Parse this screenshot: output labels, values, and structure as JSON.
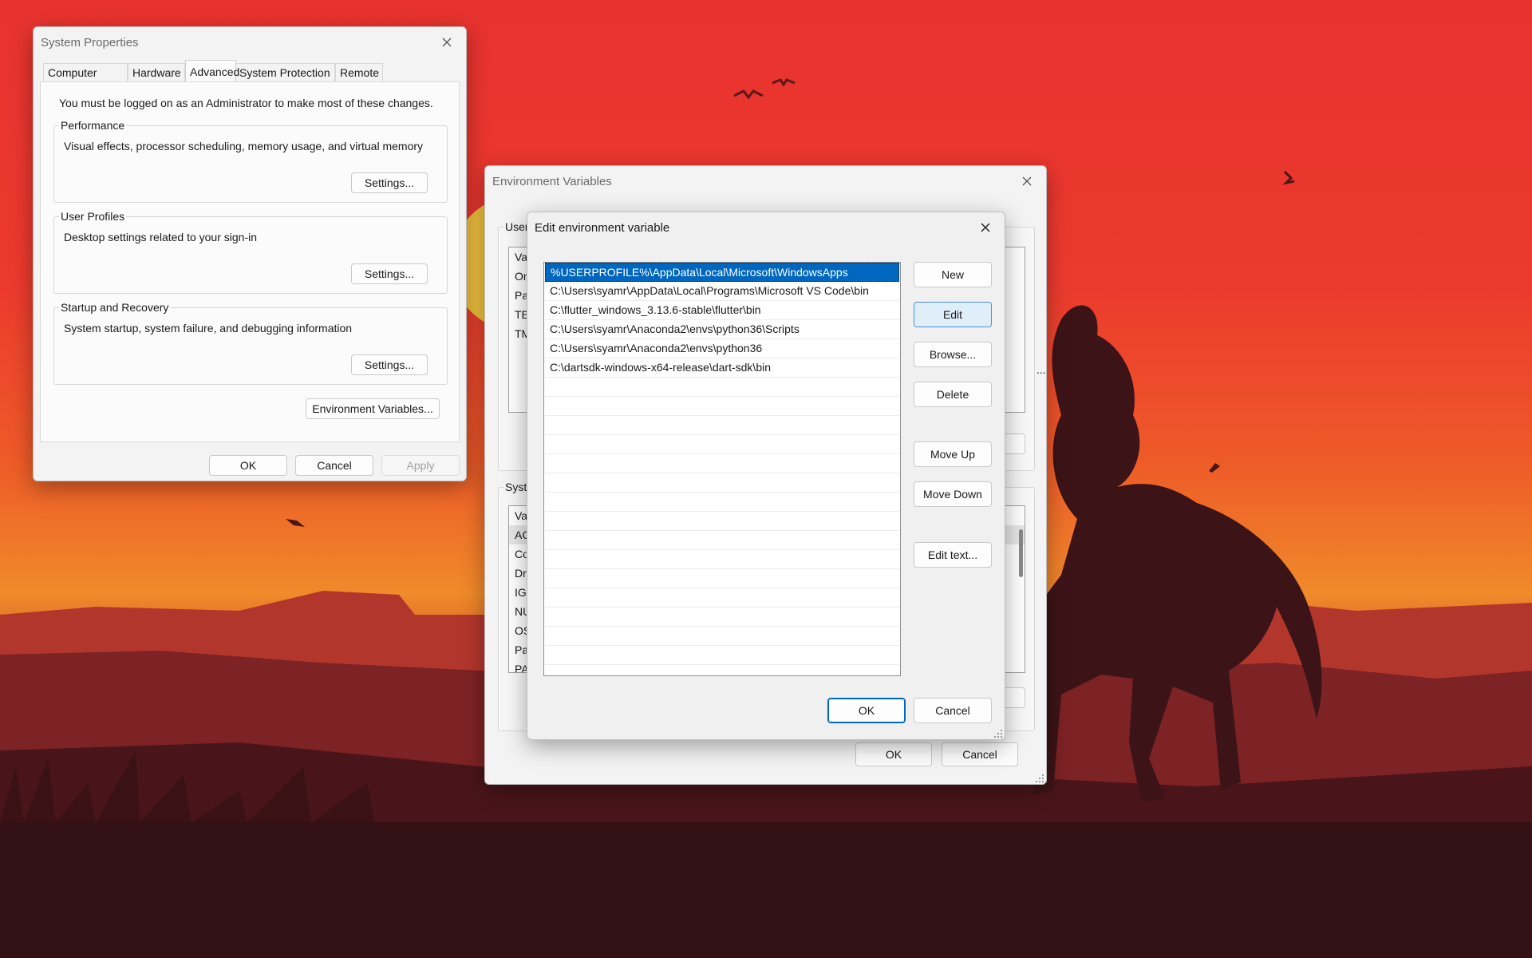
{
  "system_properties": {
    "title": "System Properties",
    "tabs": [
      "Computer Name",
      "Hardware",
      "Advanced",
      "System Protection",
      "Remote"
    ],
    "selected_tab": "Advanced",
    "admin_note": "You must be logged on as an Administrator to make most of these changes.",
    "performance": {
      "legend": "Performance",
      "desc": "Visual effects, processor scheduling, memory usage, and virtual memory",
      "button": "Settings..."
    },
    "user_profiles": {
      "legend": "User Profiles",
      "desc": "Desktop settings related to your sign-in",
      "button": "Settings..."
    },
    "startup_recovery": {
      "legend": "Startup and Recovery",
      "desc": "System startup, system failure, and debugging information",
      "button": "Settings..."
    },
    "env_button": "Environment Variables...",
    "ok": "OK",
    "cancel": "Cancel",
    "apply": "Apply"
  },
  "environment_variables": {
    "title": "Environment Variables",
    "user_group_legend": "User",
    "user_rows": [
      "Va",
      "On",
      "Pa",
      "TE",
      "TM"
    ],
    "system_group_legend": "Syste",
    "system_rows": [
      "Va",
      "AC",
      "Co",
      "Dr",
      "IG",
      "NU",
      "OS",
      "Pa",
      "PA"
    ],
    "ellipsis": "...",
    "ok": "OK",
    "cancel": "Cancel"
  },
  "edit_variable": {
    "title": "Edit environment variable",
    "paths": [
      "%USERPROFILE%\\AppData\\Local\\Microsoft\\WindowsApps",
      "C:\\Users\\syamr\\AppData\\Local\\Programs\\Microsoft VS Code\\bin",
      "C:\\flutter_windows_3.13.6-stable\\flutter\\bin",
      "C:\\Users\\syamr\\Anaconda2\\envs\\python36\\Scripts",
      "C:\\Users\\syamr\\Anaconda2\\envs\\python36",
      "C:\\dartsdk-windows-x64-release\\dart-sdk\\bin"
    ],
    "selected_index": 0,
    "buttons": {
      "new": "New",
      "edit": "Edit",
      "browse": "Browse...",
      "delete": "Delete",
      "move_up": "Move Up",
      "move_down": "Move Down",
      "edit_text": "Edit text..."
    },
    "ok": "OK",
    "cancel": "Cancel"
  },
  "colors": {
    "accent": "#0067c0",
    "selection": "#0067c0",
    "window_bg": "#f3f3f3",
    "sky_top": "#e8322f",
    "sky_horizon": "#f08a2a",
    "ground": "#3a1216"
  },
  "icons": [
    "close-icon",
    "resize-grip-icon"
  ]
}
